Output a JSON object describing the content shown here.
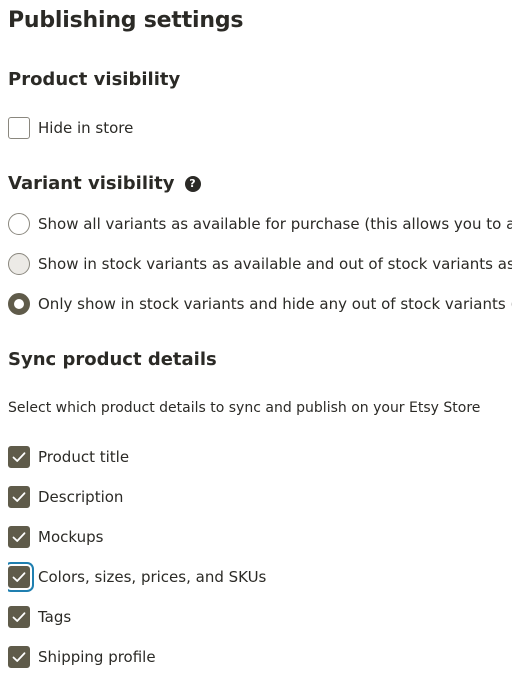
{
  "page": {
    "title": "Publishing settings"
  },
  "product_visibility": {
    "heading": "Product visibility",
    "hide_in_store": {
      "label": "Hide in store",
      "checked": false
    }
  },
  "variant_visibility": {
    "heading": "Variant visibility",
    "help_icon": "question-mark-icon",
    "help_glyph": "?",
    "options": [
      {
        "label": "Show all variants as available for purchase (this allows you to ac",
        "selected": false
      },
      {
        "label": "Show in stock variants as available and out of stock variants as '",
        "selected": false
      },
      {
        "label": "Only show in stock variants and hide any out of stock variants (t",
        "selected": true
      }
    ]
  },
  "sync": {
    "heading": "Sync product details",
    "description": "Select which product details to sync and publish on your Etsy Store",
    "items": [
      {
        "label": "Product title",
        "checked": true
      },
      {
        "label": "Description",
        "checked": true
      },
      {
        "label": "Mockups",
        "checked": true
      },
      {
        "label": "Colors, sizes, prices, and SKUs",
        "checked": true,
        "focused": true
      },
      {
        "label": "Tags",
        "checked": true
      },
      {
        "label": "Shipping profile",
        "checked": true
      }
    ]
  },
  "colors": {
    "text": "#2b2a26",
    "checked_fill": "#5f5b4a",
    "border": "#8a877e",
    "focus_ring": "#1f7fb0"
  }
}
